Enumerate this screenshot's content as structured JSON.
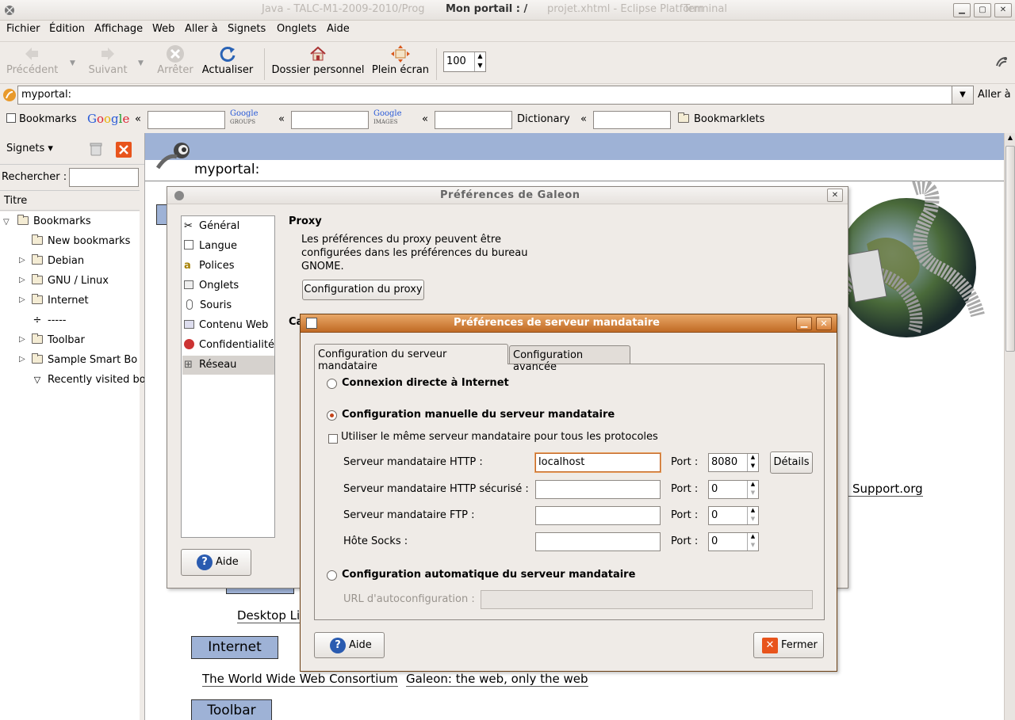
{
  "window": {
    "title": "Mon portail : /",
    "ghost_title": "Java - TALC-M1-2009-2010/Prog",
    "ghost_title_mid": "projet.xhtml - Eclipse Platform",
    "ghost_title_right": "Terminal"
  },
  "menu": [
    "Fichier",
    "Édition",
    "Affichage",
    "Web",
    "Aller à",
    "Signets",
    "Onglets",
    "Aide"
  ],
  "toolbar": {
    "back": "Précédent",
    "forward": "Suivant",
    "stop": "Arrêter",
    "reload": "Actualiser",
    "home": "Dossier personnel",
    "fullscreen": "Plein écran",
    "zoom": "100"
  },
  "location": {
    "url": "myportal:",
    "go_label": "Aller à"
  },
  "bookmarks_bar": {
    "bookmarks": "Bookmarks",
    "google": "Google",
    "groups": "Google Groups",
    "images": "Google Images",
    "dictionary": "Dictionary",
    "bookmarklets": "Bookmarklets",
    "chevron": "«"
  },
  "sidebar": {
    "selector": "Signets",
    "search_label": "Rechercher :",
    "column": "Titre",
    "items": [
      "Bookmarks",
      "New bookmarks",
      "Debian",
      "GNU / Linux",
      "Internet",
      "-----",
      "Toolbar",
      "Sample Smart Bo",
      "Recently visited bo"
    ]
  },
  "page": {
    "heading": "myportal:",
    "sections": [
      "Internet",
      "Toolbar"
    ],
    "links": [
      "Desktop Li",
      "e Support.org",
      "The World Wide Web Consortium",
      "Galeon: the web, only the web"
    ]
  },
  "prefs": {
    "title": "Préférences de Galeon",
    "nav": [
      "Général",
      "Langue",
      "Polices",
      "Onglets",
      "Souris",
      "Contenu Web",
      "Confidentialité",
      "Réseau"
    ],
    "proxy_heading": "Proxy",
    "proxy_text_1": "Les préférences du proxy peuvent être",
    "proxy_text_2": "configurées dans les préférences du bureau",
    "proxy_text_3": "GNOME.",
    "proxy_button": "Configuration du proxy",
    "cache_heading_partial": "Ca",
    "help_button": "Aide"
  },
  "proxy": {
    "title": "Préférences de serveur mandataire",
    "tab_main": "Configuration du serveur mandataire",
    "tab_adv": "Configuration avancée",
    "direct": "Connexion directe à Internet",
    "manual": "Configuration manuelle du serveur mandataire",
    "same": "Utiliser le même serveur mandataire pour tous les protocoles",
    "http_label": "Serveur mandataire HTTP :",
    "https_label": "Serveur mandataire HTTP sécurisé :",
    "ftp_label": "Serveur mandataire FTP :",
    "socks_label": "Hôte Socks :",
    "http_value": "localhost",
    "port_label": "Port :",
    "http_port": "8080",
    "https_port": "0",
    "ftp_port": "0",
    "socks_port": "0",
    "details": "Détails",
    "auto": "Configuration automatique du serveur mandataire",
    "auto_url": "URL d'autoconfiguration :",
    "help": "Aide",
    "close": "Fermer"
  }
}
